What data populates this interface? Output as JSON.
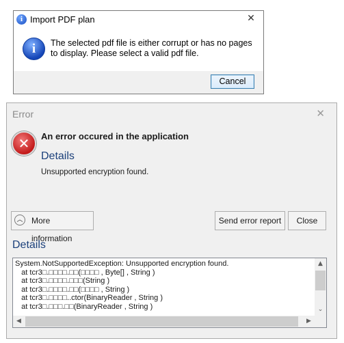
{
  "import_dialog": {
    "title": "Import PDF plan",
    "title_icon": "i",
    "close_glyph": "✕",
    "message": "The selected pdf file is either corrupt or has no pages to display. Please select a valid pdf file.",
    "message_icon": "i",
    "cancel_label": "Cancel"
  },
  "error_dialog": {
    "title": "Error",
    "close_glyph": "✕",
    "error_icon_glyph": "✕",
    "heading": "An error occured in the application",
    "details_heading": "Details",
    "error_message": "Unsupported encryption found.",
    "more_info_label": "More information",
    "more_info_chevron": "︿",
    "send_report_label": "Send error report",
    "close_label": "Close",
    "details_section_heading": "Details",
    "stack_trace": "System.NotSupportedException: Unsupported encryption found.\n   at tcr3□.□□□□.□□(□□□□ , Byte[] , String )\n   at tcr3□.□□□□.□□□(String )\n   at tcr3□.□□□□.□□(□□□□ , String )\n   at tcr3□.□□□□..ctor(BinaryReader , String )\n   at tcr3□.□□□.□□(BinaryReader , String )",
    "scroll_up_glyph": "▲",
    "scroll_down_glyph": "⌄",
    "scroll_left_glyph": "◀",
    "scroll_right_glyph": "▶"
  },
  "colors": {
    "info_icon": "#1a4fc2",
    "error_icon": "#c31a1a",
    "details_link": "#1a3f7a",
    "cancel_border": "#3c7fb1"
  }
}
